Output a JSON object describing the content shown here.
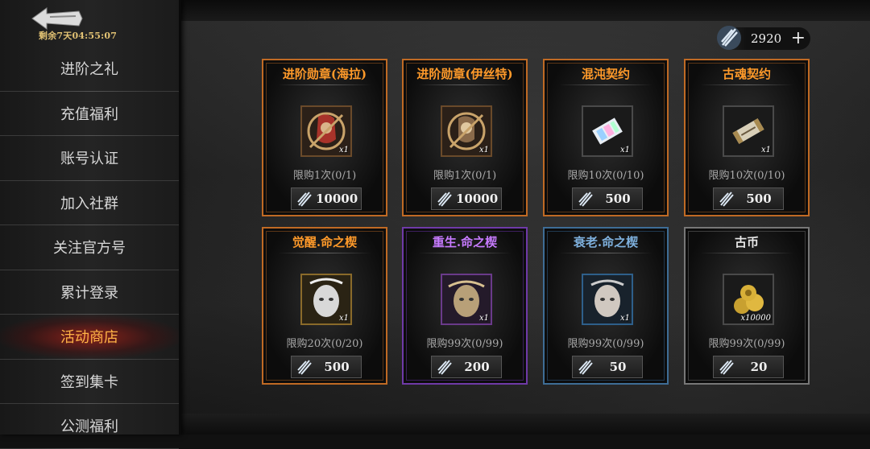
{
  "sidebar": {
    "back_icon": "back-arrow-icon",
    "timer": "剩余7天04:55:07",
    "items": [
      {
        "label": "进阶之礼",
        "active": false
      },
      {
        "label": "充值福利",
        "active": false
      },
      {
        "label": "账号认证",
        "active": false
      },
      {
        "label": "加入社群",
        "active": false
      },
      {
        "label": "关注官方号",
        "active": false
      },
      {
        "label": "累计登录",
        "active": false
      },
      {
        "label": "活动商店",
        "active": true
      },
      {
        "label": "签到集卡",
        "active": false
      },
      {
        "label": "公测福利",
        "active": false
      }
    ]
  },
  "currency": {
    "icon": "crystal-shard-icon",
    "amount": "2920",
    "plus": "+"
  },
  "shop": {
    "items": [
      {
        "title": "进阶勋章(海拉)",
        "qty": "x1",
        "limit": "限购1次(0/1)",
        "price": "10000",
        "rarity_color": "#ff9a2a",
        "icon": "hela-medal-icon"
      },
      {
        "title": "进阶勋章(伊丝特)",
        "qty": "x1",
        "limit": "限购1次(0/1)",
        "price": "10000",
        "rarity_color": "#ff9a2a",
        "icon": "ester-medal-icon"
      },
      {
        "title": "混沌契约",
        "qty": "x1",
        "limit": "限购10次(0/10)",
        "price": "500",
        "rarity_color": "#ff9a2a",
        "icon": "chaos-contract-icon"
      },
      {
        "title": "古魂契约",
        "qty": "x1",
        "limit": "限购10次(0/10)",
        "price": "500",
        "rarity_color": "#ff9a2a",
        "icon": "ancient-soul-contract-icon"
      },
      {
        "title": "觉醒.命之楔",
        "qty": "x1",
        "limit": "限购20次(0/20)",
        "price": "500",
        "rarity_color": "#ff9a2a",
        "icon": "awakening-wedge-icon"
      },
      {
        "title": "重生.命之楔",
        "qty": "x1",
        "limit": "限购99次(0/99)",
        "price": "200",
        "rarity_color": "#c77bff",
        "icon": "rebirth-wedge-icon"
      },
      {
        "title": "衰老.命之楔",
        "qty": "x1",
        "limit": "限购99次(0/99)",
        "price": "50",
        "rarity_color": "#7fb1de",
        "icon": "decay-wedge-icon"
      },
      {
        "title": "古币",
        "qty": "x10000",
        "limit": "限购99次(0/99)",
        "price": "20",
        "rarity_color": "#e8e8e8",
        "icon": "ancient-coin-icon"
      }
    ]
  }
}
